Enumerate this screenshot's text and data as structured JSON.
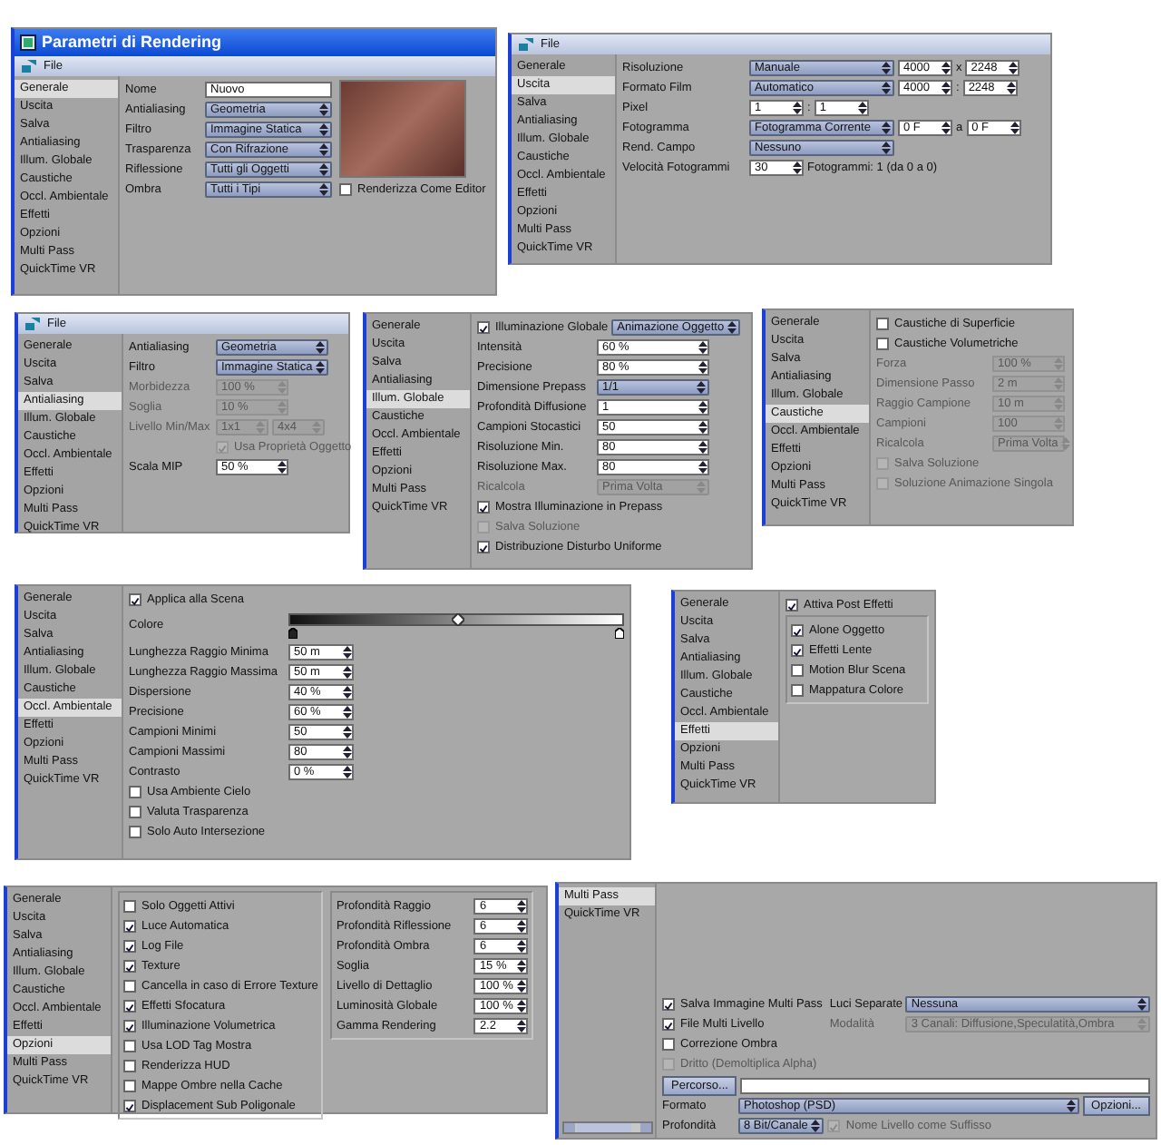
{
  "panels": [
    {
      "title": "Parametri di Rendering",
      "menu": [
        "File"
      ],
      "sidebar": [
        {
          "label": "Generale",
          "selected": true
        },
        {
          "label": "Uscita",
          "selected": false
        },
        {
          "label": "Salva",
          "selected": false
        },
        {
          "label": "Antialiasing",
          "selected": false
        },
        {
          "label": "Illum. Globale",
          "selected": false
        },
        {
          "label": "Caustiche",
          "selected": false
        },
        {
          "label": "Occl. Ambientale",
          "selected": false
        },
        {
          "label": "Effetti",
          "selected": false
        },
        {
          "label": "Opzioni",
          "selected": false
        },
        {
          "label": "Multi Pass",
          "selected": false
        },
        {
          "label": "QuickTime VR",
          "selected": false
        }
      ],
      "columns": [
        [
          {
            "kind": "row",
            "label": "Nome",
            "controls": [
              {
                "kind": "text",
                "value": "Nuovo"
              }
            ]
          },
          {
            "kind": "row",
            "label": "Antialiasing",
            "controls": [
              {
                "kind": "select",
                "value": "Geometria"
              }
            ]
          },
          {
            "kind": "row",
            "label": "Filtro",
            "controls": [
              {
                "kind": "select",
                "value": "Immagine Statica"
              }
            ]
          },
          {
            "kind": "row",
            "label": "Trasparenza",
            "controls": [
              {
                "kind": "select",
                "value": "Con Rifrazione"
              }
            ]
          },
          {
            "kind": "row",
            "label": "Riflessione",
            "controls": [
              {
                "kind": "select",
                "value": "Tutti gli Oggetti"
              }
            ]
          },
          {
            "kind": "row",
            "label": "Ombra",
            "controls": [
              {
                "kind": "select",
                "value": "Tutti i Tipi"
              }
            ]
          }
        ],
        [
          {
            "kind": "preview"
          },
          {
            "kind": "check",
            "label": "Renderizza Come Editor",
            "checked": false
          }
        ]
      ]
    },
    {
      "menu": [
        "File"
      ],
      "sidebar": [
        {
          "label": "Generale",
          "selected": false
        },
        {
          "label": "Uscita",
          "selected": true
        },
        {
          "label": "Salva",
          "selected": false
        },
        {
          "label": "Antialiasing",
          "selected": false
        },
        {
          "label": "Illum. Globale",
          "selected": false
        },
        {
          "label": "Caustiche",
          "selected": false
        },
        {
          "label": "Occl. Ambientale",
          "selected": false
        },
        {
          "label": "Effetti",
          "selected": false
        },
        {
          "label": "Opzioni",
          "selected": false
        },
        {
          "label": "Multi Pass",
          "selected": false
        },
        {
          "label": "QuickTime VR",
          "selected": false
        }
      ],
      "columns": [
        [
          {
            "kind": "row",
            "label": "Risoluzione",
            "controls": [
              {
                "kind": "select",
                "value": "Manuale"
              },
              {
                "kind": "spin",
                "value": "4000"
              },
              {
                "kind": "sep",
                "text": "x"
              },
              {
                "kind": "spin",
                "value": "2248"
              }
            ]
          },
          {
            "kind": "row",
            "label": "Formato Film",
            "controls": [
              {
                "kind": "select",
                "value": "Automatico"
              },
              {
                "kind": "spin",
                "value": "4000"
              },
              {
                "kind": "sep",
                "text": ":"
              },
              {
                "kind": "spin",
                "value": "2248"
              }
            ]
          },
          {
            "kind": "row",
            "label": "Pixel",
            "controls": [
              {
                "kind": "spin",
                "value": "1"
              },
              {
                "kind": "sep",
                "text": ":"
              },
              {
                "kind": "spin",
                "value": "1"
              }
            ]
          },
          {
            "kind": "row",
            "label": "Fotogramma",
            "controls": [
              {
                "kind": "select",
                "value": "Fotogramma Corrente"
              },
              {
                "kind": "spin",
                "value": "0 F"
              },
              {
                "kind": "sep",
                "text": "a"
              },
              {
                "kind": "spin",
                "value": "0 F"
              }
            ]
          },
          {
            "kind": "row",
            "label": "Rend. Campo",
            "controls": [
              {
                "kind": "select",
                "value": "Nessuno"
              }
            ]
          },
          {
            "kind": "row",
            "label": "Velocità Fotogrammi",
            "controls": [
              {
                "kind": "spin",
                "value": "30"
              },
              {
                "kind": "note",
                "text": "Fotogrammi: 1 (da 0 a 0)"
              }
            ]
          }
        ]
      ]
    },
    {
      "menu": [
        "File"
      ],
      "sidebar": [
        {
          "label": "Generale",
          "selected": false
        },
        {
          "label": "Uscita",
          "selected": false
        },
        {
          "label": "Salva",
          "selected": false
        },
        {
          "label": "Antialiasing",
          "selected": true
        },
        {
          "label": "Illum. Globale",
          "selected": false
        },
        {
          "label": "Caustiche",
          "selected": false
        },
        {
          "label": "Occl. Ambientale",
          "selected": false
        },
        {
          "label": "Effetti",
          "selected": false
        },
        {
          "label": "Opzioni",
          "selected": false
        },
        {
          "label": "Multi Pass",
          "selected": false
        },
        {
          "label": "QuickTime VR",
          "selected": false
        }
      ],
      "columns": [
        [
          {
            "kind": "row",
            "label": "Antialiasing",
            "controls": [
              {
                "kind": "select",
                "value": "Geometria",
                "disabled": false
              }
            ]
          },
          {
            "kind": "row",
            "label": "Filtro",
            "controls": [
              {
                "kind": "select",
                "value": "Immagine Statica",
                "disabled": false
              }
            ]
          },
          {
            "kind": "row",
            "label": "Morbidezza",
            "controls": [
              {
                "kind": "spin",
                "value": "100 %",
                "disabled": true
              }
            ]
          },
          {
            "kind": "row",
            "label": "Soglia",
            "controls": [
              {
                "kind": "spin",
                "value": "10 %",
                "disabled": true
              }
            ]
          },
          {
            "kind": "row",
            "label": "Livello Min/Max",
            "controls": [
              {
                "kind": "select",
                "value": "1x1",
                "disabled": true
              },
              {
                "kind": "select",
                "value": "4x4",
                "disabled": true
              }
            ]
          },
          {
            "kind": "check",
            "label": "Usa Proprietà Oggetto",
            "checked": true,
            "disabled": true
          },
          {
            "kind": "row",
            "label": "Scala MIP",
            "controls": [
              {
                "kind": "spin",
                "value": "50 %",
                "disabled": false
              }
            ]
          }
        ]
      ]
    },
    {
      "sidebar": [
        {
          "label": "Generale",
          "selected": false
        },
        {
          "label": "Uscita",
          "selected": false
        },
        {
          "label": "Salva",
          "selected": false
        },
        {
          "label": "Antialiasing",
          "selected": false
        },
        {
          "label": "Illum. Globale",
          "selected": true
        },
        {
          "label": "Caustiche",
          "selected": false
        },
        {
          "label": "Occl. Ambientale",
          "selected": false
        },
        {
          "label": "Effetti",
          "selected": false
        },
        {
          "label": "Opzioni",
          "selected": false
        },
        {
          "label": "Multi Pass",
          "selected": false
        },
        {
          "label": "QuickTime VR",
          "selected": false
        }
      ],
      "columns": [
        [
          {
            "kind": "row",
            "controls": [
              {
                "kind": "check",
                "label": "Illuminazione Globale",
                "checked": true,
                "disabled": false
              },
              {
                "kind": "select",
                "value": "Animazione Oggetto",
                "disabled": false
              }
            ]
          },
          {
            "kind": "row",
            "label": "Intensità",
            "controls": [
              {
                "kind": "spin",
                "value": "60 %",
                "disabled": false
              }
            ]
          },
          {
            "kind": "row",
            "label": "Precisione",
            "controls": [
              {
                "kind": "spin",
                "value": "80 %",
                "disabled": false
              }
            ]
          },
          {
            "kind": "row",
            "label": "Dimensione Prepass",
            "controls": [
              {
                "kind": "select",
                "value": "1/1",
                "disabled": false
              }
            ]
          },
          {
            "kind": "row",
            "label": "Profondità Diffusione",
            "controls": [
              {
                "kind": "spin",
                "value": "1",
                "disabled": false
              }
            ]
          },
          {
            "kind": "row",
            "label": "Campioni Stocastici",
            "controls": [
              {
                "kind": "spin",
                "value": "50",
                "disabled": false
              }
            ]
          },
          {
            "kind": "row",
            "label": "Risoluzione Min.",
            "controls": [
              {
                "kind": "spin",
                "value": "80",
                "disabled": false
              }
            ]
          },
          {
            "kind": "row",
            "label": "Risoluzione Max.",
            "controls": [
              {
                "kind": "spin",
                "value": "80",
                "disabled": false
              }
            ]
          },
          {
            "kind": "row",
            "label": "Ricalcola",
            "controls": [
              {
                "kind": "select",
                "value": "Prima Volta",
                "disabled": true
              }
            ]
          },
          {
            "kind": "check",
            "label": "Mostra Illuminazione in Prepass",
            "checked": true,
            "disabled": false
          },
          {
            "kind": "check",
            "label": "Salva Soluzione",
            "checked": false,
            "disabled": true
          },
          {
            "kind": "check",
            "label": "Distribuzione Disturbo Uniforme",
            "checked": true,
            "disabled": false
          }
        ]
      ]
    },
    {
      "sidebar": [
        {
          "label": "Generale",
          "selected": false
        },
        {
          "label": "Uscita",
          "selected": false
        },
        {
          "label": "Salva",
          "selected": false
        },
        {
          "label": "Antialiasing",
          "selected": false
        },
        {
          "label": "Illum. Globale",
          "selected": false
        },
        {
          "label": "Caustiche",
          "selected": true
        },
        {
          "label": "Occl. Ambientale",
          "selected": false
        },
        {
          "label": "Effetti",
          "selected": false
        },
        {
          "label": "Opzioni",
          "selected": false
        },
        {
          "label": "Multi Pass",
          "selected": false
        },
        {
          "label": "QuickTime VR",
          "selected": false
        }
      ],
      "columns": [
        [
          {
            "kind": "check",
            "label": "Caustiche di Superficie",
            "checked": false,
            "disabled": false
          },
          {
            "kind": "check",
            "label": "Caustiche Volumetriche",
            "checked": false,
            "disabled": false
          },
          {
            "kind": "row",
            "label": "Forza",
            "controls": [
              {
                "kind": "spin",
                "value": "100 %",
                "disabled": true
              }
            ]
          },
          {
            "kind": "row",
            "label": "Dimensione Passo",
            "controls": [
              {
                "kind": "spin",
                "value": "2 m",
                "disabled": true
              }
            ]
          },
          {
            "kind": "row",
            "label": "Raggio Campione",
            "controls": [
              {
                "kind": "spin",
                "value": "10 m",
                "disabled": true
              }
            ]
          },
          {
            "kind": "row",
            "label": "Campioni",
            "controls": [
              {
                "kind": "spin",
                "value": "100",
                "disabled": true
              }
            ]
          },
          {
            "kind": "row",
            "label": "Ricalcola",
            "controls": [
              {
                "kind": "select",
                "value": "Prima Volta",
                "disabled": true
              }
            ]
          },
          {
            "kind": "check",
            "label": "Salva Soluzione",
            "checked": false,
            "disabled": true
          },
          {
            "kind": "check",
            "label": "Soluzione Animazione Singola",
            "checked": false,
            "disabled": true
          }
        ]
      ]
    },
    {
      "sidebar": [
        {
          "label": "Generale",
          "selected": false
        },
        {
          "label": "Uscita",
          "selected": false
        },
        {
          "label": "Salva",
          "selected": false
        },
        {
          "label": "Antialiasing",
          "selected": false
        },
        {
          "label": "Illum. Globale",
          "selected": false
        },
        {
          "label": "Caustiche",
          "selected": false
        },
        {
          "label": "Occl. Ambientale",
          "selected": true
        },
        {
          "label": "Effetti",
          "selected": false
        },
        {
          "label": "Opzioni",
          "selected": false
        },
        {
          "label": "Multi Pass",
          "selected": false
        },
        {
          "label": "QuickTime VR",
          "selected": false
        }
      ],
      "columns": [
        [
          {
            "kind": "check",
            "label": "Applica alla Scena",
            "checked": true
          },
          {
            "kind": "gradient",
            "label": "Colore"
          },
          {
            "kind": "row",
            "label": "Lunghezza Raggio Minima",
            "controls": [
              {
                "kind": "spin",
                "value": "50 m"
              }
            ]
          },
          {
            "kind": "row",
            "label": "Lunghezza Raggio Massima",
            "controls": [
              {
                "kind": "spin",
                "value": "50 m"
              }
            ]
          },
          {
            "kind": "row",
            "label": "Dispersione",
            "controls": [
              {
                "kind": "spin",
                "value": "40 %"
              }
            ]
          },
          {
            "kind": "row",
            "label": "Precisione",
            "controls": [
              {
                "kind": "spin",
                "value": "60 %"
              }
            ]
          },
          {
            "kind": "row",
            "label": "Campioni Minimi",
            "controls": [
              {
                "kind": "spin",
                "value": "50"
              }
            ]
          },
          {
            "kind": "row",
            "label": "Campioni Massimi",
            "controls": [
              {
                "kind": "spin",
                "value": "80"
              }
            ]
          },
          {
            "kind": "row",
            "label": "Contrasto",
            "controls": [
              {
                "kind": "spin",
                "value": "0 %"
              }
            ]
          },
          {
            "kind": "check",
            "label": "Usa Ambiente Cielo",
            "checked": false
          },
          {
            "kind": "check",
            "label": "Valuta Trasparenza",
            "checked": false
          },
          {
            "kind": "check",
            "label": "Solo Auto Intersezione",
            "checked": false
          }
        ]
      ]
    },
    {
      "sidebar": [
        {
          "label": "Generale",
          "selected": false
        },
        {
          "label": "Uscita",
          "selected": false
        },
        {
          "label": "Salva",
          "selected": false
        },
        {
          "label": "Antialiasing",
          "selected": false
        },
        {
          "label": "Illum. Globale",
          "selected": false
        },
        {
          "label": "Caustiche",
          "selected": false
        },
        {
          "label": "Occl. Ambientale",
          "selected": false
        },
        {
          "label": "Effetti",
          "selected": true
        },
        {
          "label": "Opzioni",
          "selected": false
        },
        {
          "label": "Multi Pass",
          "selected": false
        },
        {
          "label": "QuickTime VR",
          "selected": false
        }
      ],
      "columns": [
        [
          {
            "kind": "check",
            "label": "Attiva Post Effetti",
            "checked": true
          },
          {
            "kind": "group",
            "items": [
              {
                "kind": "check",
                "label": "Alone Oggetto",
                "checked": true
              },
              {
                "kind": "check",
                "label": "Effetti Lente",
                "checked": true
              },
              {
                "kind": "check",
                "label": "Motion Blur Scena",
                "checked": false
              },
              {
                "kind": "check",
                "label": "Mappatura Colore",
                "checked": false
              }
            ]
          }
        ]
      ]
    },
    {
      "sidebar": [
        {
          "label": "Generale",
          "selected": false
        },
        {
          "label": "Uscita",
          "selected": false
        },
        {
          "label": "Salva",
          "selected": false
        },
        {
          "label": "Antialiasing",
          "selected": false
        },
        {
          "label": "Illum. Globale",
          "selected": false
        },
        {
          "label": "Caustiche",
          "selected": false
        },
        {
          "label": "Occl. Ambientale",
          "selected": false
        },
        {
          "label": "Effetti",
          "selected": false
        },
        {
          "label": "Opzioni",
          "selected": true
        },
        {
          "label": "Multi Pass",
          "selected": false
        },
        {
          "label": "QuickTime VR",
          "selected": false
        }
      ],
      "columns": [
        [
          {
            "kind": "group",
            "items": [
              {
                "kind": "check",
                "label": "Solo Oggetti Attivi",
                "checked": false
              },
              {
                "kind": "check",
                "label": "Luce Automatica",
                "checked": true
              },
              {
                "kind": "check",
                "label": "Log File",
                "checked": true
              },
              {
                "kind": "check",
                "label": "Texture",
                "checked": true
              },
              {
                "kind": "check",
                "label": "Cancella in caso di Errore Texture",
                "checked": false
              },
              {
                "kind": "check",
                "label": "Effetti Sfocatura",
                "checked": true
              },
              {
                "kind": "check",
                "label": "Illuminazione Volumetrica",
                "checked": true
              },
              {
                "kind": "check",
                "label": "Usa LOD Tag Mostra",
                "checked": false
              },
              {
                "kind": "check",
                "label": "Renderizza HUD",
                "checked": false
              },
              {
                "kind": "check",
                "label": "Mappe Ombre nella Cache",
                "checked": false
              },
              {
                "kind": "check",
                "label": "Displacement Sub Poligonale",
                "checked": true
              }
            ]
          }
        ],
        [
          {
            "kind": "group",
            "items": [
              {
                "kind": "row",
                "label": "Profondità Raggio",
                "controls": [
                  {
                    "kind": "spin",
                    "value": "6"
                  }
                ]
              },
              {
                "kind": "row",
                "label": "Profondità Riflessione",
                "controls": [
                  {
                    "kind": "spin",
                    "value": "6"
                  }
                ]
              },
              {
                "kind": "row",
                "label": "Profondità Ombra",
                "controls": [
                  {
                    "kind": "spin",
                    "value": "6"
                  }
                ]
              },
              {
                "kind": "row",
                "label": "Soglia",
                "controls": [
                  {
                    "kind": "spin",
                    "value": "15 %"
                  }
                ]
              },
              {
                "kind": "row",
                "label": "Livello di Dettaglio",
                "controls": [
                  {
                    "kind": "spin",
                    "value": "100 %"
                  }
                ]
              },
              {
                "kind": "row",
                "label": "Luminosità Globale",
                "controls": [
                  {
                    "kind": "spin",
                    "value": "100 %"
                  }
                ]
              },
              {
                "kind": "row",
                "label": "Gamma Rendering",
                "controls": [
                  {
                    "kind": "spin",
                    "value": "2.2"
                  }
                ]
              }
            ]
          }
        ]
      ]
    },
    {
      "sidebar": [
        {
          "label": "Multi Pass",
          "selected": true
        },
        {
          "label": "QuickTime VR",
          "selected": false
        }
      ],
      "columns": [
        [
          {
            "kind": "check",
            "label": "Salva Immagine Multi Pass",
            "checked": true,
            "disabled": false
          },
          {
            "kind": "check",
            "label": "File Multi Livello",
            "checked": true,
            "disabled": false
          },
          {
            "kind": "check",
            "label": "Correzione Ombra",
            "checked": false,
            "disabled": false
          },
          {
            "kind": "check",
            "label": "Dritto (Demoltiplica Alpha)",
            "checked": false,
            "disabled": true
          }
        ],
        [
          {
            "kind": "row",
            "label": "Luci Separate",
            "controls": [
              {
                "kind": "select",
                "value": "Nessuna",
                "disabled": false
              }
            ]
          },
          {
            "kind": "row",
            "label": "Modalità",
            "controls": [
              {
                "kind": "select",
                "value": "3 Canali: Diffusione,Speculatità,Ombra",
                "disabled": true
              }
            ]
          }
        ]
      ],
      "footer": [
        {
          "kind": "row",
          "controls": [
            {
              "kind": "button",
              "label": "Percorso..."
            },
            {
              "kind": "text"
            }
          ]
        },
        {
          "kind": "row",
          "label": "Formato",
          "controls": [
            {
              "kind": "select",
              "value": "Photoshop (PSD)",
              "disabled": false
            },
            {
              "kind": "button",
              "label": "Opzioni..."
            }
          ]
        },
        {
          "kind": "row",
          "label": "Profondità",
          "controls": [
            {
              "kind": "select",
              "value": "8 Bit/Canale",
              "disabled": false
            },
            {
              "kind": "check",
              "label": "Nome Livello come Suffisso",
              "checked": true,
              "disabled": true
            }
          ]
        }
      ]
    }
  ]
}
